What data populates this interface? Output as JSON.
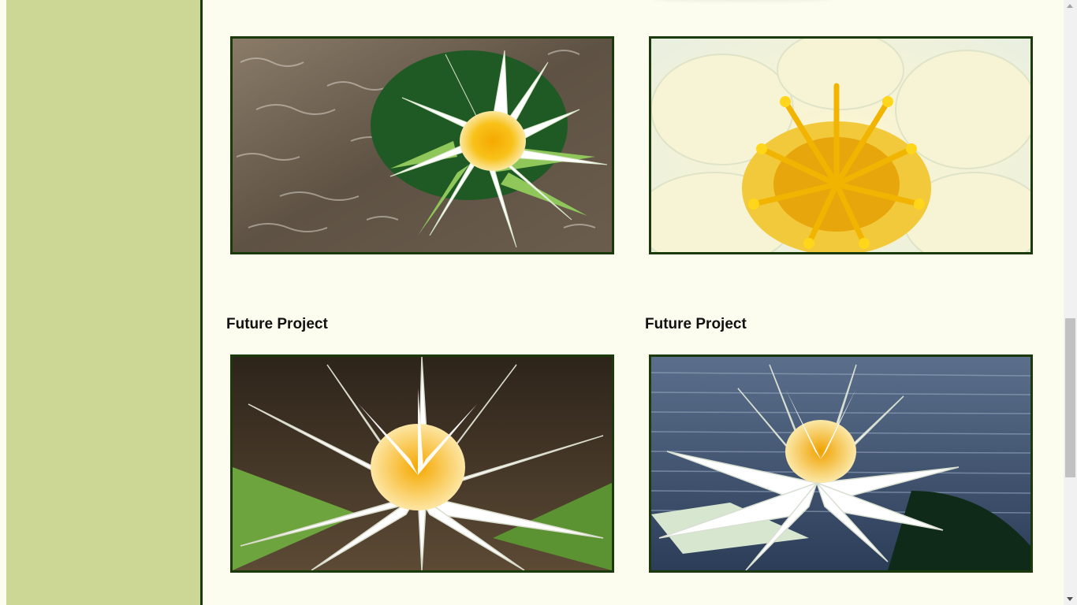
{
  "gallery": {
    "cards": [
      {
        "title": "",
        "image": "white-water-lily-on-rippled-water"
      },
      {
        "title": "",
        "image": "water-lily-yellow-stamens-closeup"
      },
      {
        "title": "Future Project",
        "image": "white-water-lily-on-dark-background"
      },
      {
        "title": "Future Project",
        "image": "white-water-lily-on-blue-water"
      }
    ]
  },
  "colors": {
    "page_background": "#fcfdef",
    "sidebar_background": "#ccd796",
    "sidebar_border": "#1b3a0c",
    "photo_border": "#1a3a0c"
  },
  "scrollbar": {
    "position": 0.55
  }
}
